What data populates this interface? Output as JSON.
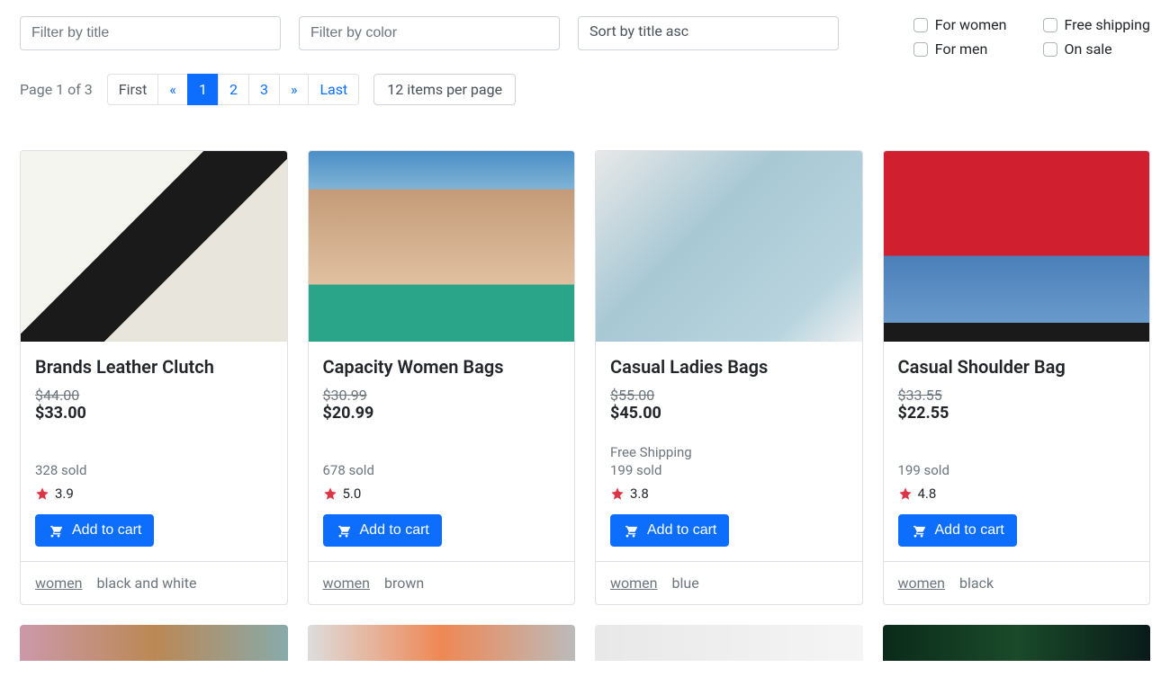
{
  "filters": {
    "title_placeholder": "Filter by title",
    "color_placeholder": "Filter by color",
    "sort_label": "Sort by title asc"
  },
  "checkboxes": {
    "for_women": "For women",
    "for_men": "For men",
    "free_shipping": "Free shipping",
    "on_sale": "On sale"
  },
  "pagination": {
    "page_info": "Page 1 of 3",
    "first": "First",
    "prev": "«",
    "p1": "1",
    "p2": "2",
    "p3": "3",
    "next": "»",
    "last": "Last",
    "per_page": "12 items per page"
  },
  "products": [
    {
      "title": "Brands Leather Clutch",
      "price_old": "$44.00",
      "price_new": "$33.00",
      "shipping": "",
      "sold": "328 sold",
      "rating": "3.9",
      "add_label": "Add to cart",
      "tag": "women",
      "color": "black and white"
    },
    {
      "title": "Capacity Women Bags",
      "price_old": "$30.99",
      "price_new": "$20.99",
      "shipping": "",
      "sold": "678 sold",
      "rating": "5.0",
      "add_label": "Add to cart",
      "tag": "women",
      "color": "brown"
    },
    {
      "title": "Casual Ladies Bags",
      "price_old": "$55.00",
      "price_new": "$45.00",
      "shipping": "Free Shipping",
      "sold": "199 sold",
      "rating": "3.8",
      "add_label": "Add to cart",
      "tag": "women",
      "color": "blue"
    },
    {
      "title": "Casual Shoulder Bag",
      "price_old": "$33.55",
      "price_new": "$22.55",
      "shipping": "",
      "sold": "199 sold",
      "rating": "4.8",
      "add_label": "Add to cart",
      "tag": "women",
      "color": "black"
    }
  ]
}
